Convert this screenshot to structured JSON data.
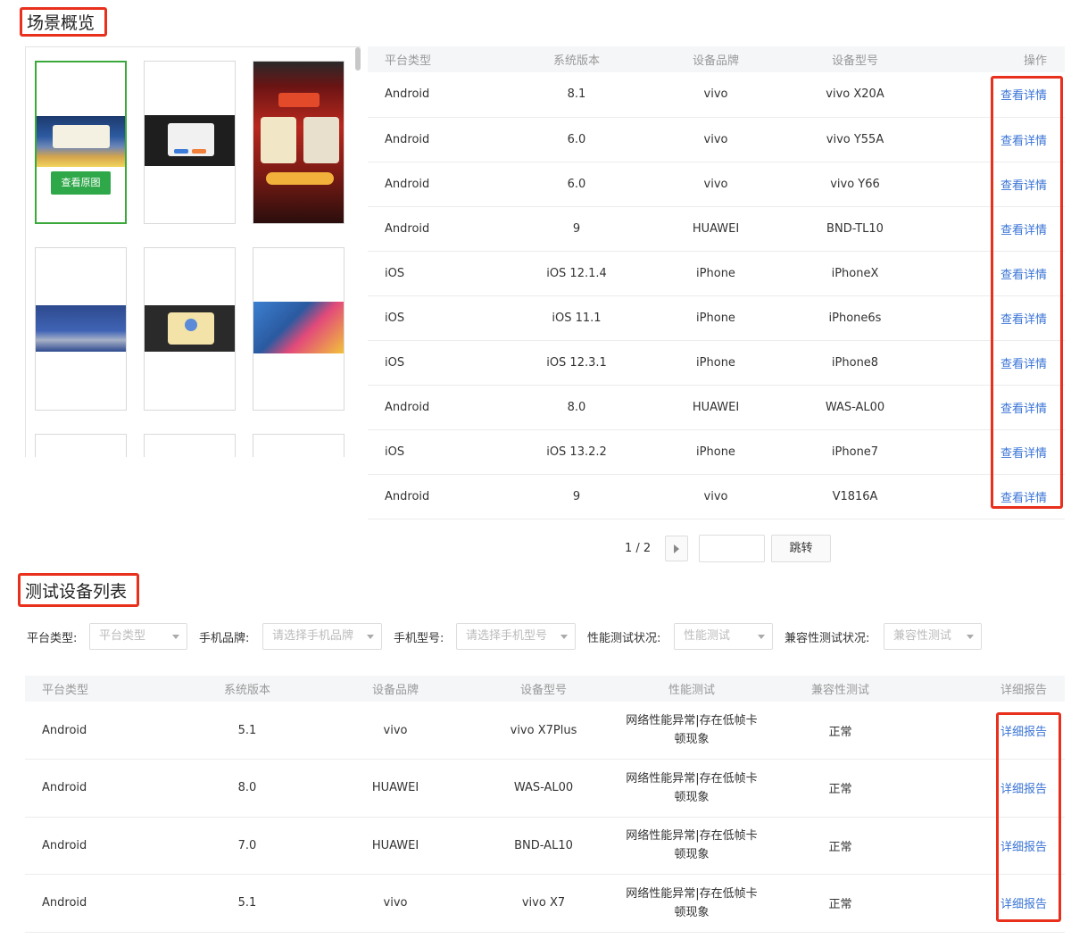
{
  "scene_section": {
    "title": "场景概览",
    "view_original_label": "查看原图",
    "table": {
      "headers": [
        "平台类型",
        "系统版本",
        "设备品牌",
        "设备型号",
        "操作"
      ],
      "rows": [
        [
          "Android",
          "8.1",
          "vivo",
          "vivo X20A",
          "查看详情"
        ],
        [
          "Android",
          "6.0",
          "vivo",
          "vivo Y55A",
          "查看详情"
        ],
        [
          "Android",
          "6.0",
          "vivo",
          "vivo Y66",
          "查看详情"
        ],
        [
          "Android",
          "9",
          "HUAWEI",
          "BND-TL10",
          "查看详情"
        ],
        [
          "iOS",
          "iOS 12.1.4",
          "iPhone",
          "iPhoneX",
          "查看详情"
        ],
        [
          "iOS",
          "iOS 11.1",
          "iPhone",
          "iPhone6s",
          "查看详情"
        ],
        [
          "iOS",
          "iOS 12.3.1",
          "iPhone",
          "iPhone8",
          "查看详情"
        ],
        [
          "Android",
          "8.0",
          "HUAWEI",
          "WAS-AL00",
          "查看详情"
        ],
        [
          "iOS",
          "iOS 13.2.2",
          "iPhone",
          "iPhone7",
          "查看详情"
        ],
        [
          "Android",
          "9",
          "vivo",
          "V1816A",
          "查看详情"
        ]
      ]
    },
    "pagination": {
      "page_text": "1 / 2",
      "jump_label": "跳转",
      "jump_value": ""
    }
  },
  "device_section": {
    "title": "测试设备列表",
    "filters": [
      {
        "label": "平台类型:",
        "placeholder": "平台类型"
      },
      {
        "label": "手机品牌:",
        "placeholder": "请选择手机品牌"
      },
      {
        "label": "手机型号:",
        "placeholder": "请选择手机型号"
      },
      {
        "label": "性能测试状况:",
        "placeholder": "性能测试"
      },
      {
        "label": "兼容性测试状况:",
        "placeholder": "兼容性测试"
      }
    ],
    "table": {
      "headers": [
        "平台类型",
        "系统版本",
        "设备品牌",
        "设备型号",
        "性能测试",
        "兼容性测试",
        "详细报告"
      ],
      "rows": [
        [
          "Android",
          "5.1",
          "vivo",
          "vivo X7Plus",
          "网络性能异常|存在低帧卡",
          "顿现象",
          "正常",
          "详细报告"
        ],
        [
          "Android",
          "8.0",
          "HUAWEI",
          "WAS-AL00",
          "网络性能异常|存在低帧卡",
          "顿现象",
          "正常",
          "详细报告"
        ],
        [
          "Android",
          "7.0",
          "HUAWEI",
          "BND-AL10",
          "网络性能异常|存在低帧卡",
          "顿现象",
          "正常",
          "详细报告"
        ],
        [
          "Android",
          "5.1",
          "vivo",
          "vivo X7",
          "网络性能异常|存在低帧卡",
          "顿现象",
          "正常",
          "详细报告"
        ]
      ]
    }
  },
  "colors": {
    "accent_link": "#3a74d6",
    "highlight_red": "#e8301c",
    "selected_green": "#3aa83a",
    "button_green": "#2fa84a"
  }
}
